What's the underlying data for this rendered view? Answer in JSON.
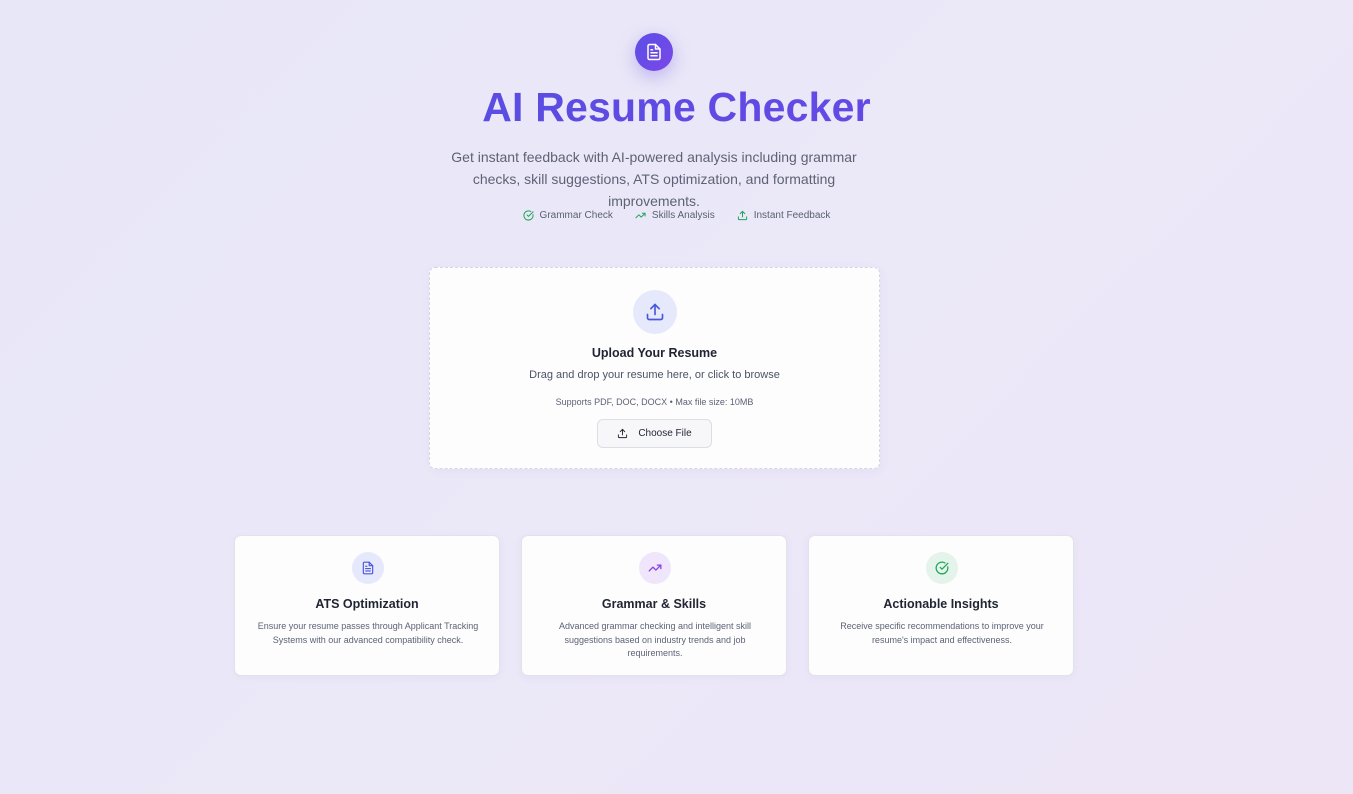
{
  "hero": {
    "icon": "document-icon",
    "title": "AI Resume Checker",
    "subtitle": "Get instant feedback with AI-powered analysis including grammar checks, skill suggestions, ATS optimization, and formatting improvements."
  },
  "features": [
    {
      "icon": "check-circle-icon",
      "label": "Grammar Check"
    },
    {
      "icon": "trending-up-icon",
      "label": "Skills Analysis"
    },
    {
      "icon": "upload-icon",
      "label": "Instant Feedback"
    }
  ],
  "upload": {
    "icon": "upload-icon",
    "title": "Upload Your Resume",
    "description": "Drag and drop your resume here, or click to browse",
    "support": "Supports PDF, DOC, DOCX • Max file size: 10MB",
    "button_label": "Choose File"
  },
  "cards": [
    {
      "icon": "document-icon",
      "title": "ATS Optimization",
      "description": "Ensure your resume passes through Applicant Tracking Systems with our advanced compatibility check."
    },
    {
      "icon": "trending-up-icon",
      "title": "Grammar & Skills",
      "description": "Advanced grammar checking and intelligent skill suggestions based on industry trends and job requirements."
    },
    {
      "icon": "check-circle-icon",
      "title": "Actionable Insights",
      "description": "Receive specific recommendations to improve your resume's impact and effectiveness."
    }
  ],
  "colors": {
    "accent": "#5b4ee5",
    "accent_purple": "#7b47e8",
    "success_green": "#22a55a",
    "background": "#ebe8f8"
  }
}
